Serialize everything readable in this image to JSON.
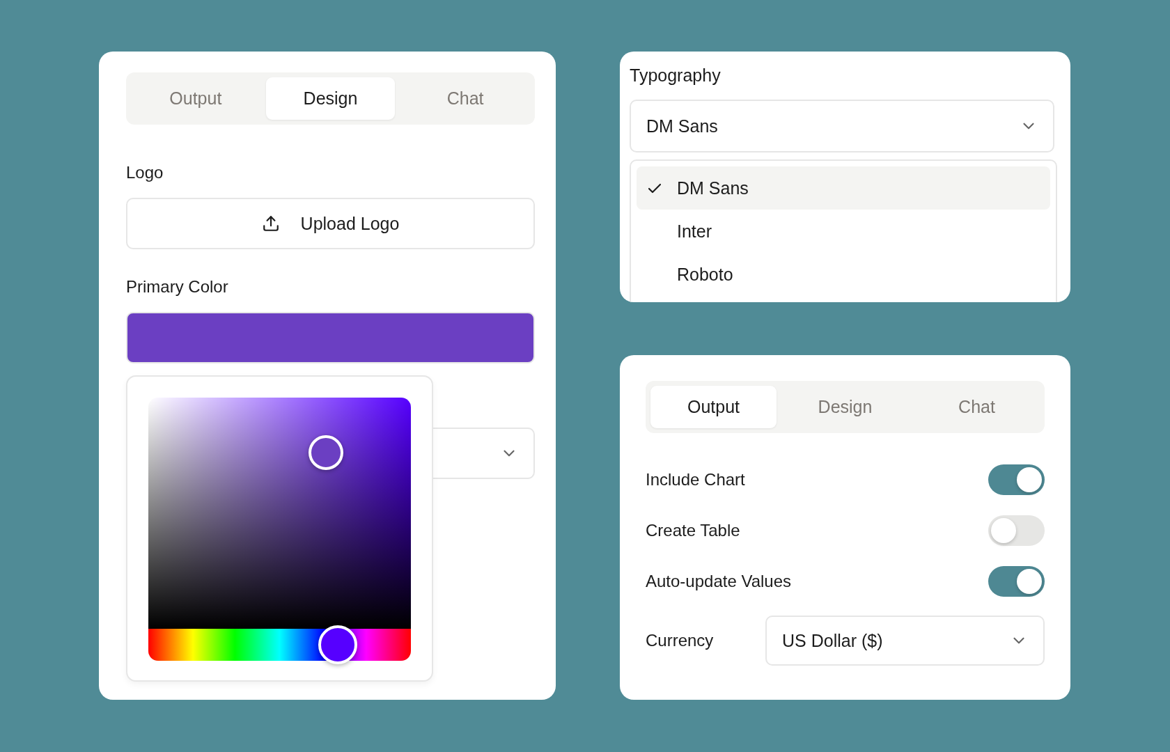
{
  "design_panel": {
    "tabs": [
      {
        "label": "Output",
        "selected": false
      },
      {
        "label": "Design",
        "selected": true
      },
      {
        "label": "Chat",
        "selected": false
      }
    ],
    "logo": {
      "label": "Logo",
      "button": "Upload Logo"
    },
    "primary_color": {
      "label": "Primary Color",
      "color": "#6b3fc2"
    }
  },
  "typography": {
    "label": "Typography",
    "value": "DM Sans",
    "options": [
      {
        "label": "DM Sans",
        "selected": true
      },
      {
        "label": "Inter",
        "selected": false
      },
      {
        "label": "Roboto",
        "selected": false
      }
    ]
  },
  "output_panel": {
    "tabs": [
      {
        "label": "Output",
        "selected": true
      },
      {
        "label": "Design",
        "selected": false
      },
      {
        "label": "Chat",
        "selected": false
      }
    ],
    "toggles": [
      {
        "label": "Include Chart",
        "on": true
      },
      {
        "label": "Create Table",
        "on": false
      },
      {
        "label": "Auto-update Values",
        "on": true
      }
    ],
    "currency": {
      "label": "Currency",
      "value": "US Dollar ($)"
    }
  }
}
